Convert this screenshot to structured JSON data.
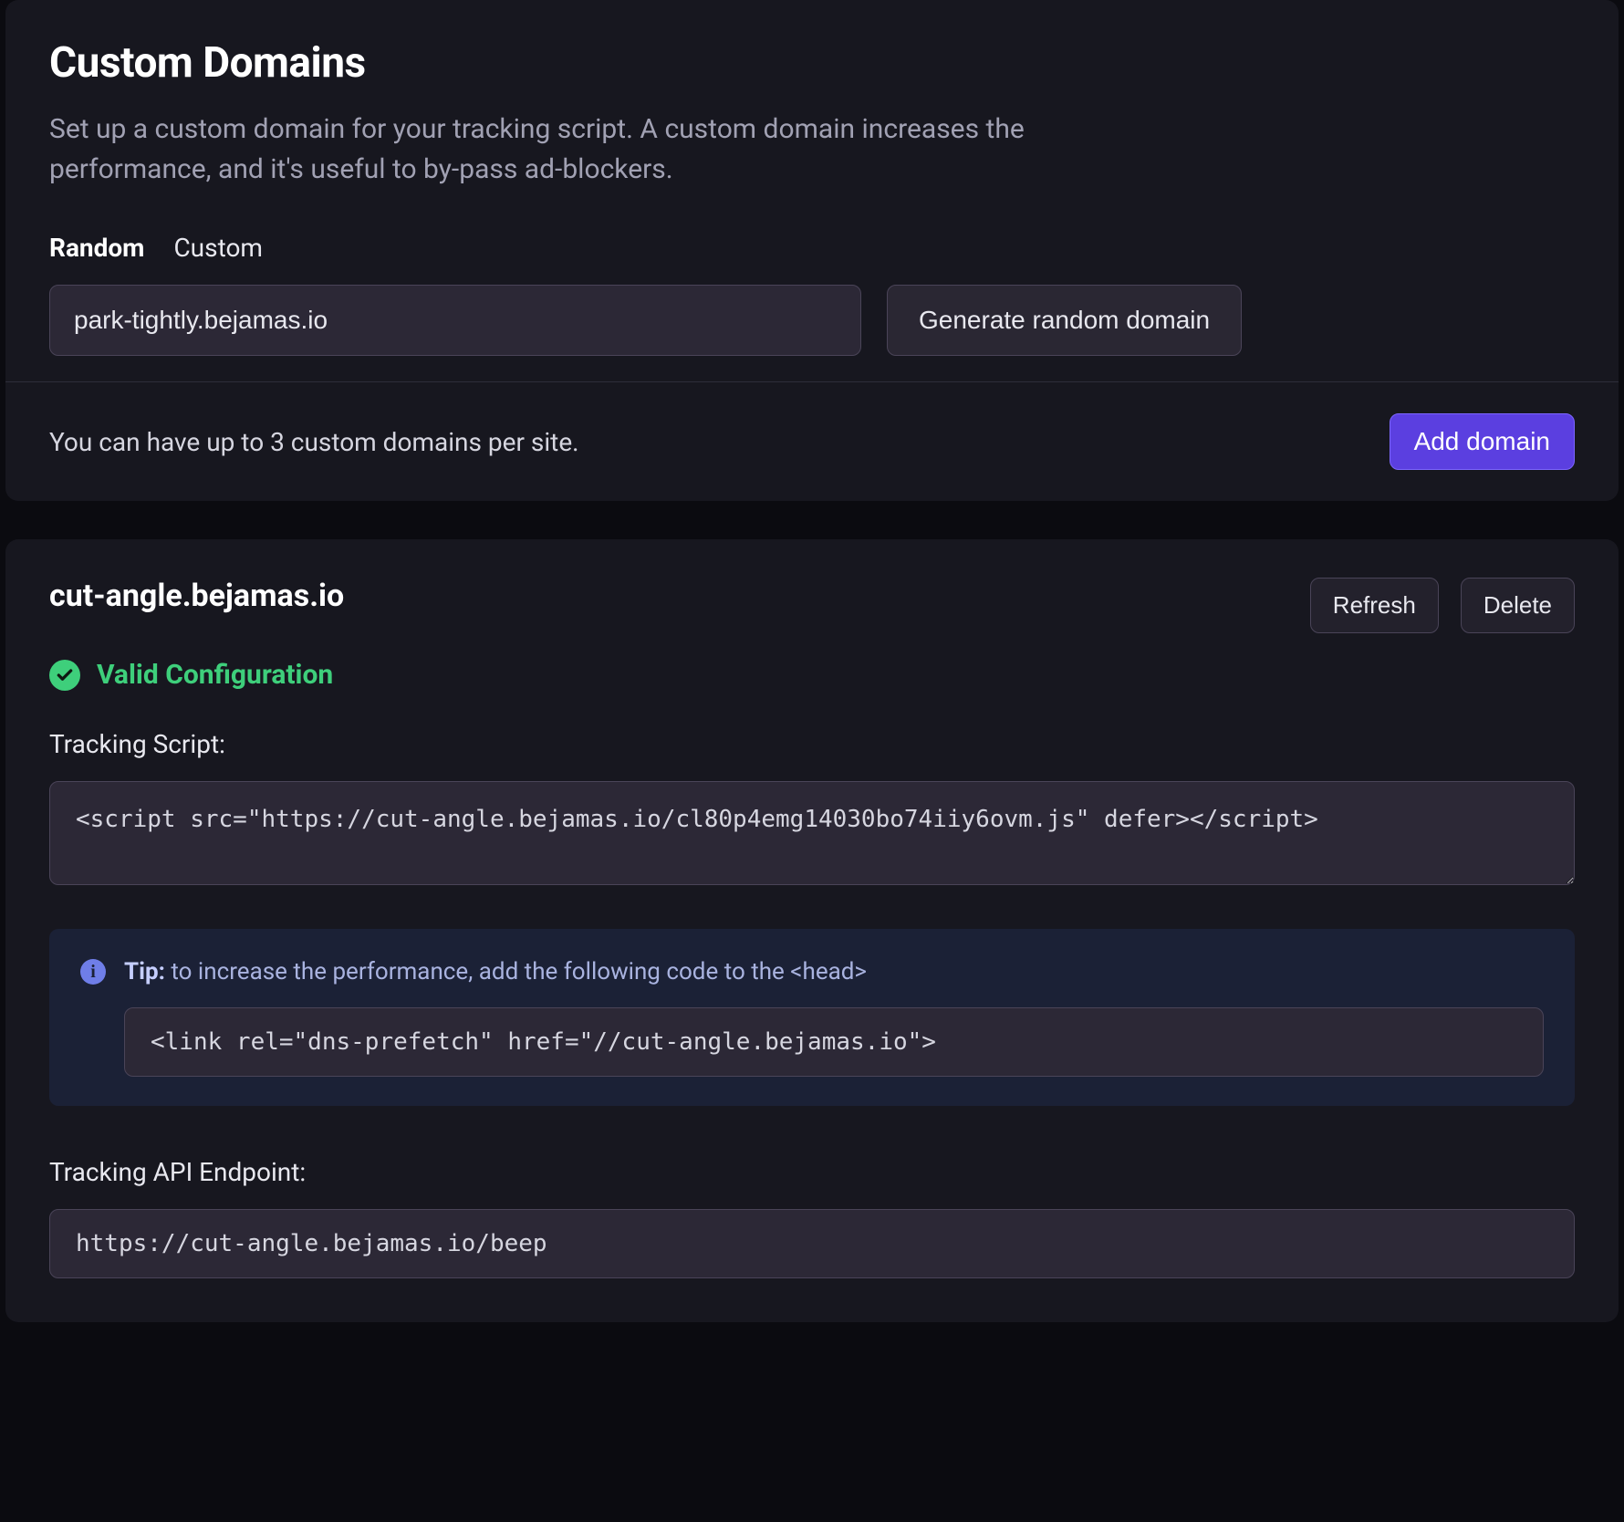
{
  "custom_domains": {
    "title": "Custom Domains",
    "description": "Set up a custom domain for your tracking script. A custom domain increases the performance, and it's useful to by-pass ad-blockers.",
    "tabs": {
      "random": "Random",
      "custom": "Custom",
      "active": "random"
    },
    "random_domain_value": "park-tightly.bejamas.io",
    "generate_button": "Generate random domain",
    "footer_note": "You can have up to 3 custom domains per site.",
    "add_button": "Add domain"
  },
  "domain_detail": {
    "name": "cut-angle.bejamas.io",
    "refresh_button": "Refresh",
    "delete_button": "Delete",
    "status_text": "Valid Configuration",
    "tracking_script_label": "Tracking Script:",
    "tracking_script_code": "<script src=\"https://cut-angle.bejamas.io/cl80p4emg14030bo74iiy6ovm.js\" defer></script>",
    "tip_label": "Tip:",
    "tip_text": " to increase the performance, add the following code to the <head>",
    "tip_code": "<link rel=\"dns-prefetch\" href=\"//cut-angle.bejamas.io\">",
    "api_endpoint_label": "Tracking API Endpoint:",
    "api_endpoint_value": "https://cut-angle.bejamas.io/beep"
  }
}
